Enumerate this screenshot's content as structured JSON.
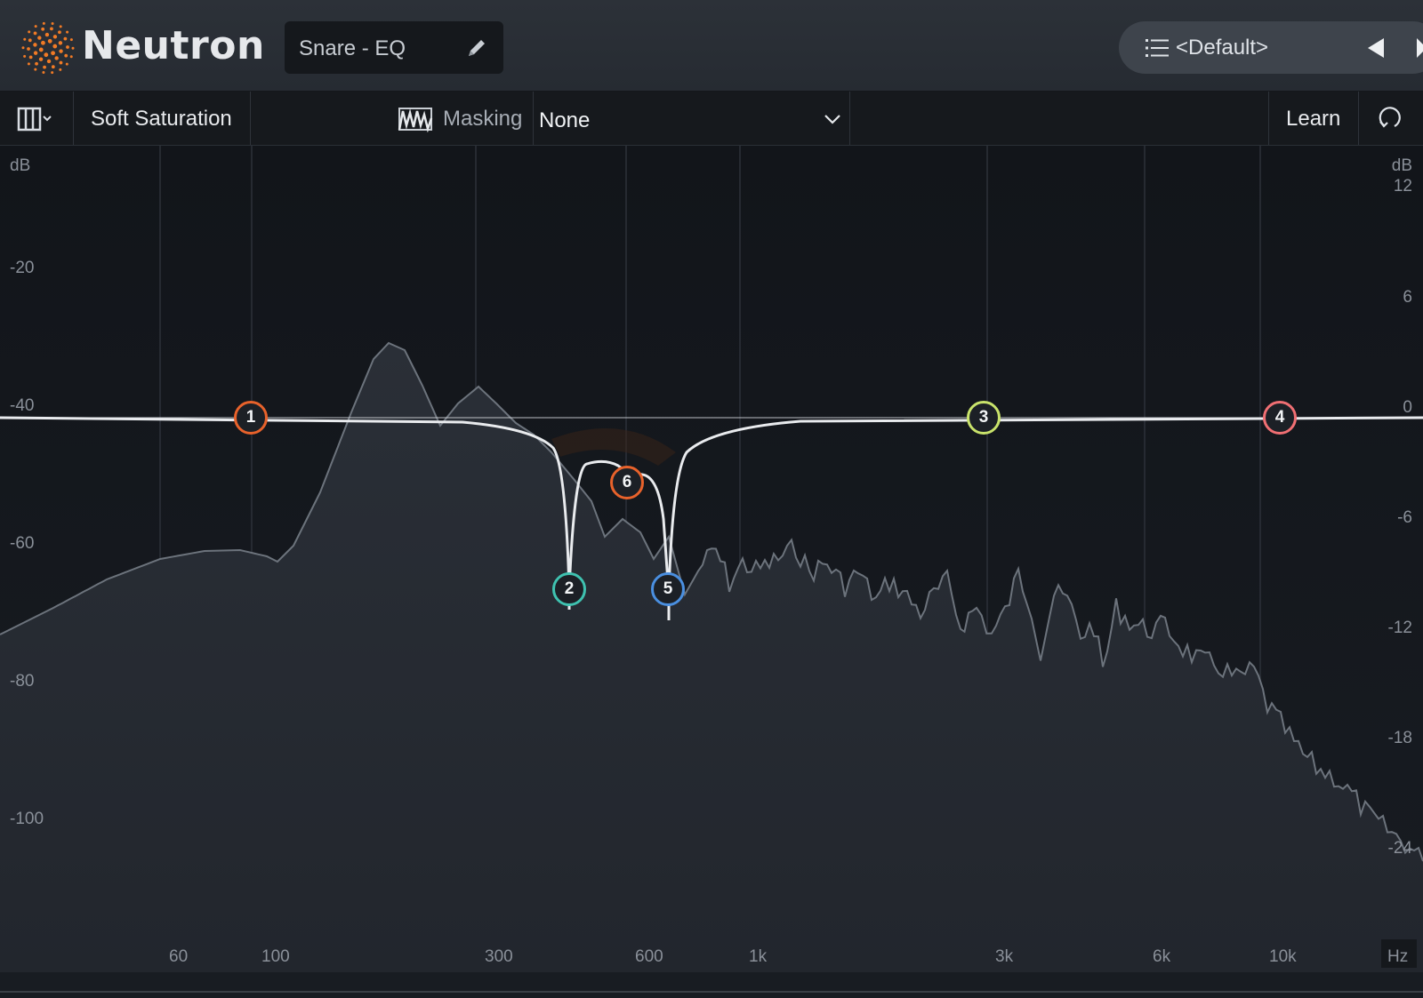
{
  "header": {
    "brand": "Neutron",
    "module_name": "Snare - EQ",
    "preset": "<Default>"
  },
  "toolbar": {
    "mode": "Soft Saturation",
    "masking_label": "Masking",
    "masking_value": "None",
    "learn_label": "Learn"
  },
  "graph": {
    "left_db_unit": "dB",
    "left_db_ticks": [
      "-20",
      "-40",
      "-60",
      "-80",
      "-100"
    ],
    "right_db_unit": "dB",
    "right_db_ticks": [
      "12",
      "6",
      "0",
      "-6",
      "-12",
      "-18",
      "-24"
    ],
    "freq_ticks": [
      "60",
      "100",
      "300",
      "600",
      "1k",
      "3k",
      "6k",
      "10k"
    ],
    "freq_unit": "Hz"
  },
  "eq_nodes": [
    {
      "label": "1",
      "color": "#e8622b"
    },
    {
      "label": "2",
      "color": "#3fc2b0"
    },
    {
      "label": "3",
      "color": "#c9e36b"
    },
    {
      "label": "4",
      "color": "#f06f73"
    },
    {
      "label": "5",
      "color": "#4a8fe0"
    },
    {
      "label": "6",
      "color": "#e8622b"
    }
  ],
  "colors": {
    "accent": "#e8622b",
    "background": "#0e1014",
    "spectrum_fill": "#262b33",
    "eq_curve": "#e9ebee"
  },
  "icons": [
    "neutron-logo-icon",
    "pencil-icon",
    "list-icon",
    "prev-arrow-icon",
    "next-arrow-icon",
    "view-columns-icon",
    "masking-waveform-icon",
    "chevron-down-icon",
    "reset-icon"
  ]
}
